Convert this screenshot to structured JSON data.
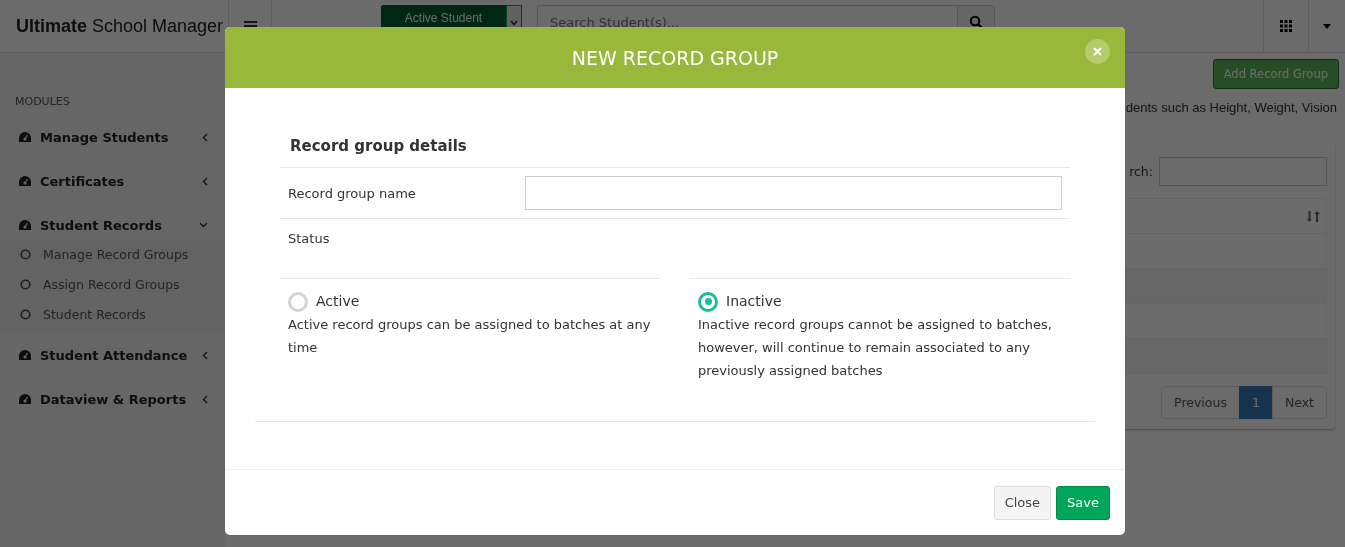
{
  "header": {
    "brand_bold": "Ultimate",
    "brand_rest": "School Manager",
    "student_filter": "Active Student",
    "search": {
      "placeholder": "Search Student(s)..."
    }
  },
  "sidebar": {
    "heading": "MODULES",
    "items": [
      {
        "label": "Manage Students",
        "expanded": false
      },
      {
        "label": "Certificates",
        "expanded": false
      },
      {
        "label": "Student Records",
        "expanded": true,
        "children": [
          {
            "label": "Manage Record Groups"
          },
          {
            "label": "Assign Record Groups"
          },
          {
            "label": "Student Records"
          }
        ]
      },
      {
        "label": "Student Attendance",
        "expanded": false
      },
      {
        "label": "Dataview & Reports",
        "expanded": false
      }
    ]
  },
  "content": {
    "add_button": "Add Record Group",
    "description": "dents such as Height, Weight, Vision",
    "search_label": "rch:",
    "pagination": [
      {
        "label": "Previous",
        "selected": false
      },
      {
        "label": "1",
        "selected": true
      },
      {
        "label": "Next",
        "selected": false
      }
    ]
  },
  "modal": {
    "title": "NEW RECORD GROUP",
    "section": "Record group details",
    "name_label": "Record group name",
    "status_label": "Status",
    "status_options": [
      {
        "label": "Active",
        "description": "Active record groups can be assigned to batches at any time",
        "selected": false
      },
      {
        "label": "Inactive",
        "description": "Inactive record groups cannot be assigned to batches, however, will continue to remain associated to any previously assigned batches",
        "selected": true
      }
    ],
    "buttons": [
      {
        "label": "Close",
        "kind": "default"
      },
      {
        "label": "Save",
        "kind": "primary"
      }
    ]
  }
}
